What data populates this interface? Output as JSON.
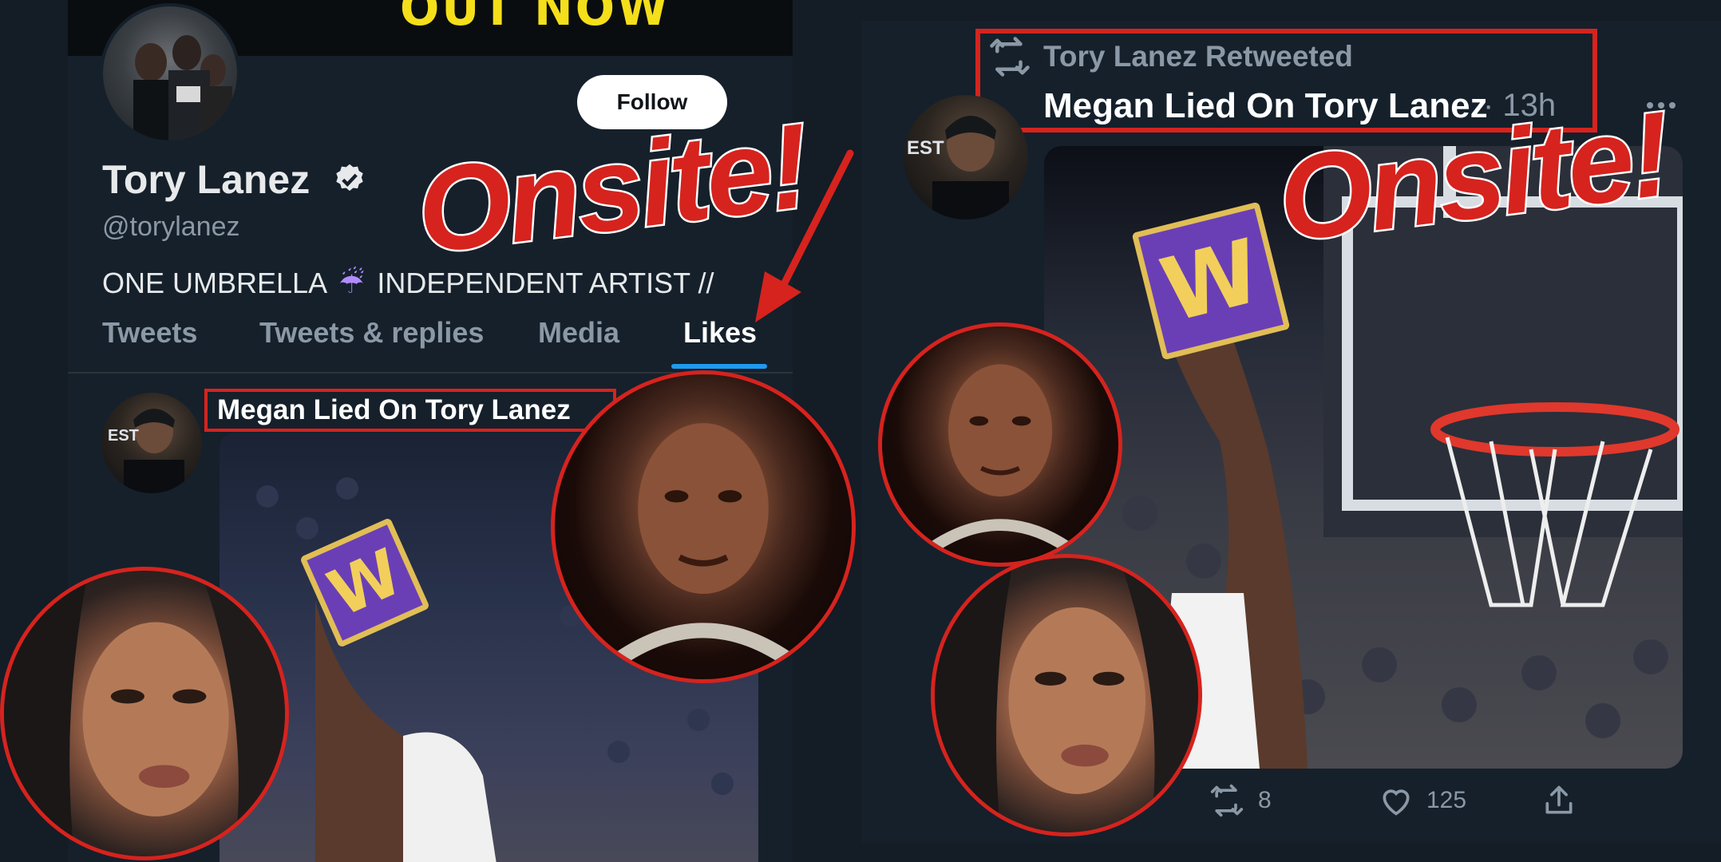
{
  "colors": {
    "background": "#15202b",
    "accent_blue": "#1d9bf0",
    "highlight_red": "#d6231e",
    "muted_text": "#8b98a5",
    "primary_text": "#e7e9ea"
  },
  "banner": {
    "text": "OUT NOW"
  },
  "profile": {
    "display_name": "Tory Lanez",
    "handle": "@torylanez",
    "bio_part1": "ONE UMBRELLA",
    "bio_part2": "INDEPENDENT ARTIST //",
    "bio_icon": "umbrella-icon",
    "follow_label": "Follow",
    "verified_icon": "verified-badge-icon"
  },
  "tabs": [
    {
      "label": "Tweets",
      "active": false
    },
    {
      "label": "Tweets & replies",
      "active": false
    },
    {
      "label": "Media",
      "active": false
    },
    {
      "label": "Likes",
      "active": true
    }
  ],
  "left_tweet": {
    "title": "Megan Lied On Tory Lanez"
  },
  "right_tweet": {
    "retweeted_label": "Tory Lanez Retweeted",
    "title": "Megan Lied On Tory Lanez",
    "time": "· 13h",
    "retweet_count": "8",
    "like_count": "125",
    "more_icon": "more-options-icon"
  },
  "overlays": {
    "watermark": "Onsite!",
    "card_letter": "W"
  }
}
